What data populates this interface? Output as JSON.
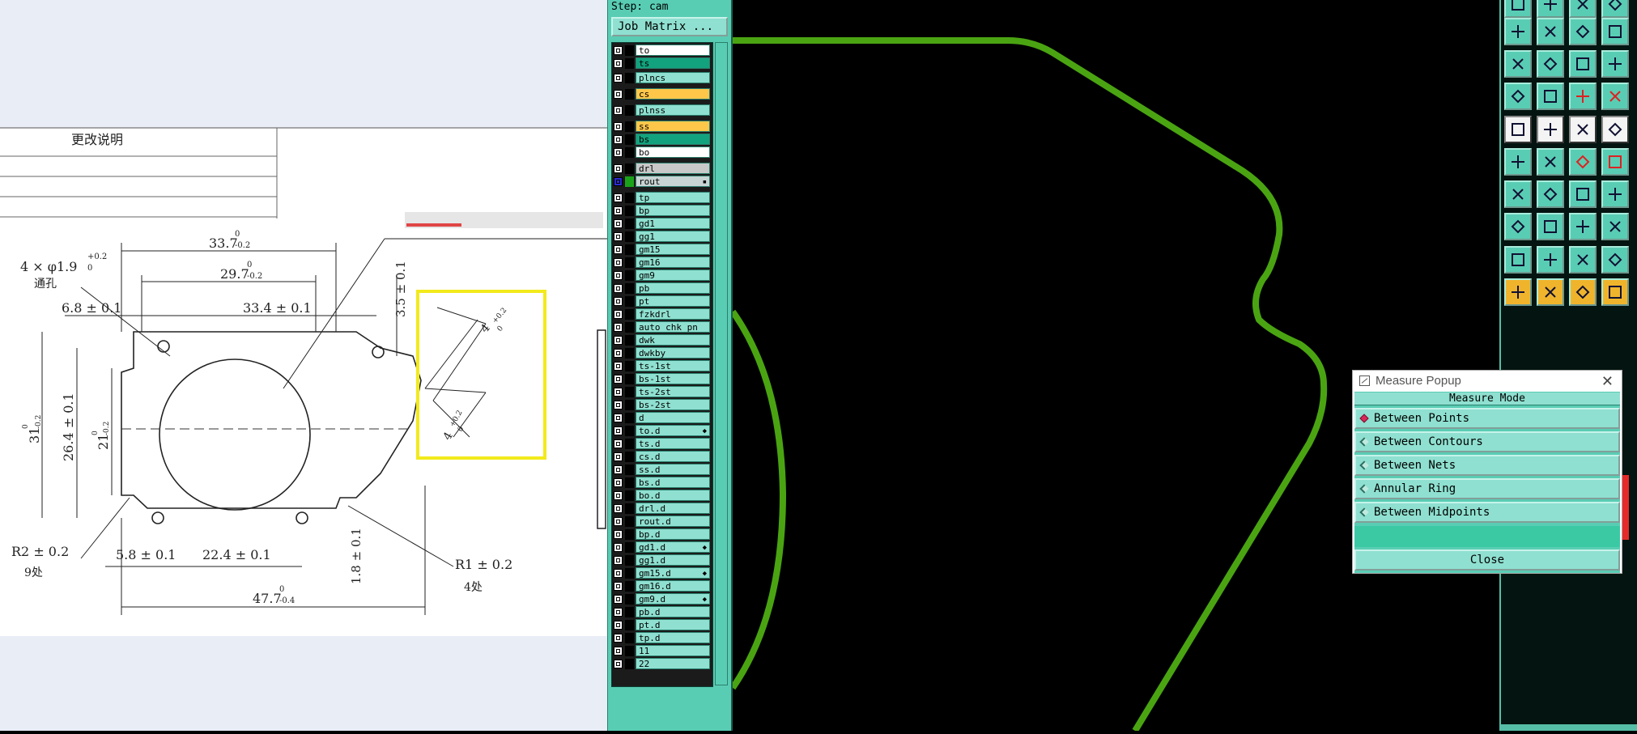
{
  "drawing": {
    "revision_header": "更改说明",
    "dims": {
      "top_width": "33.7",
      "top_width_tol_upper": "0",
      "top_width_tol_lower": "-0.2",
      "inner_width": "29.7",
      "inner_width_tol_upper": "0",
      "inner_width_tol_lower": "-0.2",
      "hole_note": "4 × φ1.9",
      "hole_tol_upper": "+0.2",
      "hole_tol_lower": "0",
      "hole_note_2": "通孔",
      "offset_left": "6.8 ± 0.1",
      "hole_span": "33.4 ± 0.1",
      "slot_offset": "3.5 ± 0.1",
      "height_outer": "31",
      "height_outer_tol_upper": "0",
      "height_outer_tol_lower": "-0.2",
      "height_mid": "26.4 ± 0.1",
      "height_inner": "21",
      "height_inner_tol_upper": "0",
      "height_inner_tol_lower": "-0.2",
      "radius_corner": "R2 ± 0.2",
      "radius_corner_count": "9处",
      "bottom_left": "5.8 ± 0.1",
      "bottom_mid": "22.4 ± 0.1",
      "bottom_notch": "1.8 ± 0.1",
      "radius_small": "R1 ± 0.2",
      "radius_small_count": "4处",
      "total_width": "47.7",
      "total_width_tol_upper": "0",
      "total_width_tol_lower": "-0.4",
      "detail_dim_1": "4",
      "detail_dim_1_tol_upper": "+0.2",
      "detail_dim_1_tol_lower": "0",
      "detail_dim_2": "4",
      "detail_dim_2_tol_upper": "+0.2",
      "detail_dim_2_tol_lower": "0"
    }
  },
  "layer_panel": {
    "step_title": "Step: cam",
    "job_matrix_label": "Job Matrix ...",
    "layers": [
      {
        "name": "to",
        "color": "#ffffff",
        "style": "white",
        "mark": ""
      },
      {
        "name": "ts",
        "color": "#12a37e",
        "style": "green",
        "mark": ""
      },
      {
        "name": "plncs",
        "color": "#8fe0d0",
        "style": "",
        "mark": ""
      },
      {
        "name": "cs",
        "color": "#ffc74a",
        "style": "orange",
        "mark": ""
      },
      {
        "name": "plnss",
        "color": "#8fe0d0",
        "style": "",
        "mark": ""
      },
      {
        "name": "ss",
        "color": "#ffc74a",
        "style": "orange",
        "mark": ""
      },
      {
        "name": "bs",
        "color": "#12a37e",
        "style": "green",
        "mark": ""
      },
      {
        "name": "bo",
        "color": "#ffffff",
        "style": "white",
        "mark": ""
      },
      {
        "name": "drl",
        "color": "#c8c8c8",
        "style": "grey",
        "mark": ""
      },
      {
        "name": "rout",
        "color": "#c8d3d3",
        "style": "rout",
        "mark": "▪"
      },
      {
        "name": "tp",
        "color": "#8fe0d0",
        "style": "",
        "mark": ""
      },
      {
        "name": "bp",
        "color": "#8fe0d0",
        "style": "",
        "mark": ""
      },
      {
        "name": "gd1",
        "color": "#8fe0d0",
        "style": "",
        "mark": ""
      },
      {
        "name": "gg1",
        "color": "#8fe0d0",
        "style": "",
        "mark": ""
      },
      {
        "name": "gm15",
        "color": "#8fe0d0",
        "style": "",
        "mark": ""
      },
      {
        "name": "gm16",
        "color": "#8fe0d0",
        "style": "",
        "mark": ""
      },
      {
        "name": "gm9",
        "color": "#8fe0d0",
        "style": "",
        "mark": ""
      },
      {
        "name": "pb",
        "color": "#8fe0d0",
        "style": "",
        "mark": ""
      },
      {
        "name": "pt",
        "color": "#8fe0d0",
        "style": "",
        "mark": ""
      },
      {
        "name": "fzkdrl",
        "color": "#8fe0d0",
        "style": "",
        "mark": ""
      },
      {
        "name": "auto_chk_pn",
        "color": "#8fe0d0",
        "style": "",
        "mark": ""
      },
      {
        "name": "dwk",
        "color": "#8fe0d0",
        "style": "",
        "mark": ""
      },
      {
        "name": "dwkby",
        "color": "#8fe0d0",
        "style": "",
        "mark": ""
      },
      {
        "name": "ts-1st",
        "color": "#8fe0d0",
        "style": "",
        "mark": ""
      },
      {
        "name": "bs-1st",
        "color": "#8fe0d0",
        "style": "",
        "mark": ""
      },
      {
        "name": "ts-2st",
        "color": "#8fe0d0",
        "style": "",
        "mark": ""
      },
      {
        "name": "bs-2st",
        "color": "#8fe0d0",
        "style": "",
        "mark": ""
      },
      {
        "name": "d",
        "color": "#8fe0d0",
        "style": "",
        "mark": ""
      },
      {
        "name": "to.d",
        "color": "#8fe0d0",
        "style": "",
        "mark": "◆"
      },
      {
        "name": "ts.d",
        "color": "#8fe0d0",
        "style": "",
        "mark": ""
      },
      {
        "name": "cs.d",
        "color": "#8fe0d0",
        "style": "",
        "mark": ""
      },
      {
        "name": "ss.d",
        "color": "#8fe0d0",
        "style": "",
        "mark": ""
      },
      {
        "name": "bs.d",
        "color": "#8fe0d0",
        "style": "",
        "mark": ""
      },
      {
        "name": "bo.d",
        "color": "#8fe0d0",
        "style": "",
        "mark": ""
      },
      {
        "name": "drl.d",
        "color": "#8fe0d0",
        "style": "",
        "mark": ""
      },
      {
        "name": "rout.d",
        "color": "#8fe0d0",
        "style": "",
        "mark": ""
      },
      {
        "name": "bp.d",
        "color": "#8fe0d0",
        "style": "",
        "mark": ""
      },
      {
        "name": "gd1.d",
        "color": "#8fe0d0",
        "style": "",
        "mark": "◆"
      },
      {
        "name": "gg1.d",
        "color": "#8fe0d0",
        "style": "",
        "mark": ""
      },
      {
        "name": "gm15.d",
        "color": "#8fe0d0",
        "style": "",
        "mark": "◆"
      },
      {
        "name": "gm16.d",
        "color": "#8fe0d0",
        "style": "",
        "mark": ""
      },
      {
        "name": "gm9.d",
        "color": "#8fe0d0",
        "style": "",
        "mark": "◆"
      },
      {
        "name": "pb.d",
        "color": "#8fe0d0",
        "style": "",
        "mark": ""
      },
      {
        "name": "pt.d",
        "color": "#8fe0d0",
        "style": "",
        "mark": ""
      },
      {
        "name": "tp.d",
        "color": "#8fe0d0",
        "style": "",
        "mark": ""
      },
      {
        "name": "11",
        "color": "#8fe0d0",
        "style": "",
        "mark": ""
      },
      {
        "name": "22",
        "color": "#8fe0d0",
        "style": "",
        "mark": ""
      }
    ]
  },
  "canvas": {
    "outline_color": "#4aa412",
    "background": "#000000"
  },
  "toolbar": {
    "rows": [
      [
        "window-icon",
        "move-icon",
        "panel-icon",
        "step-icon"
      ],
      [
        "zoom-left-icon",
        "zoom-right-icon",
        "split-icon",
        "redo-icon"
      ],
      [
        "fit-icon",
        "pan-icon",
        "scale-1-2-icon",
        "help-icon"
      ],
      [
        "route-icon",
        "pin-icon",
        "layer-red-icon",
        "layer-red2-icon"
      ],
      [
        "pad-add-icon",
        "edit-shape-icon",
        "dash-icon",
        "dot-icon"
      ],
      [
        "snap-node-icon",
        "intersect-icon",
        "snap-red-icon",
        "snap-red2-icon"
      ],
      [
        "angle-icon",
        "line-snap-icon",
        "arc-icon",
        "frame-icon"
      ],
      [
        "corner-icon",
        "minus-icon",
        "center-icon",
        "grid-icon"
      ],
      [
        "triangle-icon",
        "triangle2-icon",
        "triangle3-icon",
        "triangle4-icon"
      ],
      [
        "select-icon",
        "select-orange-icon",
        "select-rot-icon",
        "select-multi-icon"
      ]
    ]
  },
  "measure_popup": {
    "title": "Measure Popup",
    "close_glyph": "✕",
    "mode_label": "Measure Mode",
    "modes": [
      {
        "label": "Between Points",
        "selected": true
      },
      {
        "label": "Between Contours",
        "selected": false
      },
      {
        "label": "Between Nets",
        "selected": false
      },
      {
        "label": "Annular Ring",
        "selected": false
      },
      {
        "label": "Between Midpoints",
        "selected": false
      }
    ],
    "close_label": "Close"
  }
}
